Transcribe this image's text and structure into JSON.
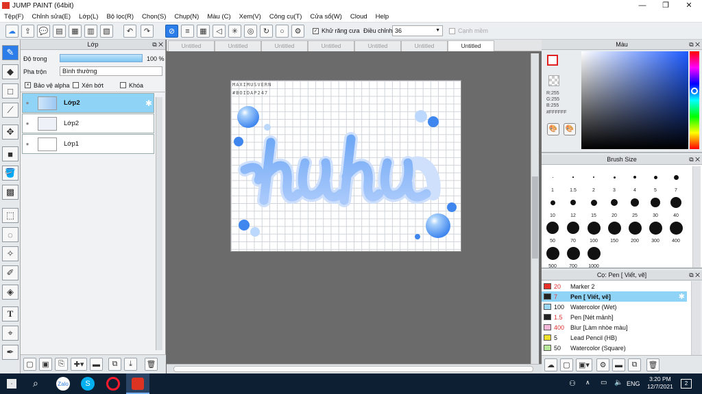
{
  "window": {
    "title": "JUMP PAINT (64bit)",
    "minimize": "—",
    "restore": "❐",
    "close": "✕"
  },
  "menu": [
    "Tệp(F)",
    "Chỉnh sửa(E)",
    "Lớp(L)",
    "Bộ lọc(R)",
    "Chọn(S)",
    "Chụp(N)",
    "Màu (C)",
    "Xem(V)",
    "Công cụ(T)",
    "Cửa sổ(W)",
    "Cloud",
    "Help"
  ],
  "toolbar": {
    "antialias_label": "Khử răng cưa",
    "adjust_label": "Điều chỉnh",
    "adjust_value": "36",
    "snap_label": "Cạnh mềm"
  },
  "layer_panel": {
    "title": "Lớp",
    "opacity_label": "Độ trong",
    "opacity_value": "100 %",
    "blend_label": "Pha trộn",
    "blend_value": "Bình thường",
    "protect_alpha": "Bảo vệ alpha",
    "clip": "Xén bớt",
    "lock": "Khóa",
    "layers": [
      {
        "name": "Lớp2",
        "selected": true
      },
      {
        "name": "Lớp2",
        "selected": false
      },
      {
        "name": "Lớp1",
        "selected": false
      }
    ]
  },
  "tabs": [
    "Untitled",
    "Untitled",
    "Untitled",
    "Untitled",
    "Untitled",
    "Untitled",
    "Untitled"
  ],
  "canvas": {
    "watermark1": "MAXIMUSVERN",
    "watermark2": "#BOIDAP247",
    "art_text": "huhu"
  },
  "color_panel": {
    "title": "Màu",
    "r": "R:255",
    "g": "G:255",
    "b": "B:255",
    "hex": "#FFFFFF"
  },
  "brush_size": {
    "title": "Brush Size",
    "sizes": [
      "1",
      "1.5",
      "2",
      "3",
      "4",
      "5",
      "7",
      "10",
      "12",
      "15",
      "20",
      "25",
      "30",
      "40",
      "50",
      "70",
      "100",
      "150",
      "200",
      "300",
      "400",
      "500",
      "700",
      "1000"
    ]
  },
  "brush_list": {
    "title": "Cọ: Pen [ Viết, vẽ]",
    "items": [
      {
        "size": "20",
        "name": "Marker 2",
        "color": "#e8302a",
        "sel": false,
        "red": true
      },
      {
        "size": "7",
        "name": "Pen [ Viết, vẽ]",
        "color": "#222222",
        "sel": true,
        "red": true
      },
      {
        "size": "100",
        "name": "Watercolor (Wet)",
        "color": "#9ad8f5",
        "sel": false,
        "red": false
      },
      {
        "size": "1.5",
        "name": "Pen [Nét mảnh]",
        "color": "#222222",
        "sel": false,
        "red": true
      },
      {
        "size": "400",
        "name": "Blur [Làm nhòe màu]",
        "color": "#f4b6d8",
        "sel": false,
        "red": true
      },
      {
        "size": "5",
        "name": "Lead Pencil (HB)",
        "color": "#f1e02a",
        "sel": false,
        "red": false
      },
      {
        "size": "50",
        "name": "Watercolor (Square)",
        "color": "#b8e89a",
        "sel": false,
        "red": false
      }
    ]
  },
  "taskbar": {
    "lang": "ENG",
    "time": "3:20 PM",
    "date": "12/7/2021",
    "notif": "2"
  }
}
